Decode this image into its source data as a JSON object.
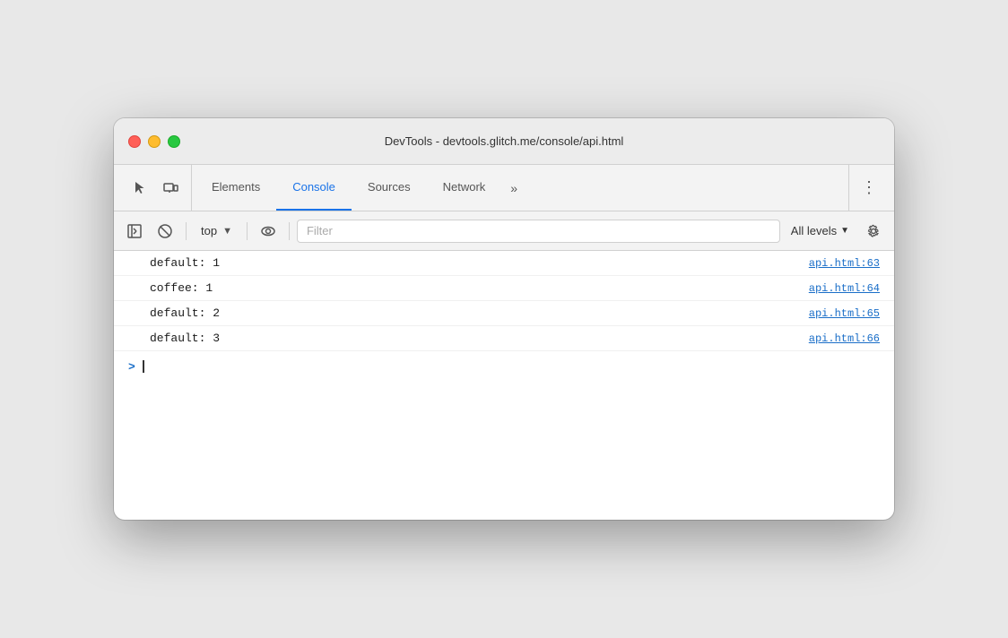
{
  "window": {
    "title": "DevTools - devtools.glitch.me/console/api.html"
  },
  "tabs": [
    {
      "id": "elements",
      "label": "Elements",
      "active": false
    },
    {
      "id": "console",
      "label": "Console",
      "active": true
    },
    {
      "id": "sources",
      "label": "Sources",
      "active": false
    },
    {
      "id": "network",
      "label": "Network",
      "active": false
    }
  ],
  "more_tabs_label": "»",
  "more_menu_label": "⋮",
  "console_toolbar": {
    "clear_label": "🚫",
    "context_value": "top",
    "dropdown_arrow": "▼",
    "filter_placeholder": "Filter",
    "levels_label": "All levels",
    "levels_arrow": "▼"
  },
  "console_rows": [
    {
      "text": "default: 1",
      "link": "api.html:63"
    },
    {
      "text": "coffee: 1",
      "link": "api.html:64"
    },
    {
      "text": "default: 2",
      "link": "api.html:65"
    },
    {
      "text": "default: 3",
      "link": "api.html:66"
    }
  ],
  "prompt_symbol": ">",
  "traffic_lights": {
    "close_title": "Close",
    "minimize_title": "Minimize",
    "maximize_title": "Maximize"
  }
}
